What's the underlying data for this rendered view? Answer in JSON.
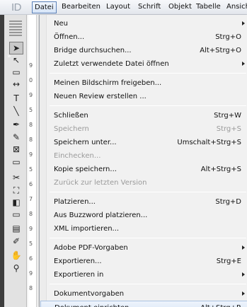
{
  "menubar": {
    "app_logo": "ID",
    "items": [
      "Datei",
      "Bearbeiten",
      "Layout",
      "Schrift",
      "Objekt",
      "Tabelle",
      "Ansicht"
    ],
    "active": "Datei"
  },
  "ruler_numbers": [
    "9",
    "0",
    "9",
    "5",
    "8",
    "8",
    "9",
    "5",
    "6",
    "7",
    "8",
    "9",
    "5",
    "6",
    "9",
    "8"
  ],
  "tools": [
    {
      "name": "selection-tool-icon",
      "glyph": "➤"
    },
    {
      "name": "direct-selection-tool-icon",
      "glyph": "↖"
    },
    {
      "name": "page-tool-icon",
      "glyph": "▭"
    },
    {
      "name": "gap-tool-icon",
      "glyph": "↔"
    },
    {
      "name": "type-tool-icon",
      "glyph": "T"
    },
    {
      "name": "line-tool-icon",
      "glyph": "╲"
    },
    {
      "name": "pen-tool-icon",
      "glyph": "✒"
    },
    {
      "name": "pencil-tool-icon",
      "glyph": "✎"
    },
    {
      "name": "rectangle-frame-tool-icon",
      "glyph": "⊠"
    },
    {
      "name": "rectangle-tool-icon",
      "glyph": "▭"
    },
    {
      "name": "scissors-tool-icon",
      "glyph": "✂"
    },
    {
      "name": "free-transform-tool-icon",
      "glyph": "⛶"
    },
    {
      "name": "gradient-swatch-tool-icon",
      "glyph": "◧"
    },
    {
      "name": "gradient-feather-tool-icon",
      "glyph": "▭"
    },
    {
      "name": "note-tool-icon",
      "glyph": "▤"
    },
    {
      "name": "eyedropper-tool-icon",
      "glyph": "✐"
    },
    {
      "name": "hand-tool-icon",
      "glyph": "✋"
    },
    {
      "name": "zoom-tool-icon",
      "glyph": "⚲"
    }
  ],
  "file_menu": [
    {
      "label": "Neu",
      "shortcut": "",
      "submenu": true,
      "disabled": false
    },
    {
      "label": "Öffnen...",
      "shortcut": "Strg+O",
      "submenu": false,
      "disabled": false
    },
    {
      "label": "Bridge durchsuchen...",
      "shortcut": "Alt+Strg+O",
      "submenu": false,
      "disabled": false
    },
    {
      "label": "Zuletzt verwendete Datei öffnen",
      "shortcut": "",
      "submenu": true,
      "disabled": false
    },
    {
      "label": "Meinen Bildschirm freigeben...",
      "shortcut": "",
      "submenu": false,
      "disabled": false
    },
    {
      "label": "Neuen Review erstellen ...",
      "shortcut": "",
      "submenu": false,
      "disabled": false
    },
    {
      "label": "Schließen",
      "shortcut": "Strg+W",
      "submenu": false,
      "disabled": false
    },
    {
      "label": "Speichern",
      "shortcut": "Strg+S",
      "submenu": false,
      "disabled": true
    },
    {
      "label": "Speichern unter...",
      "shortcut": "Umschalt+Strg+S",
      "submenu": false,
      "disabled": false
    },
    {
      "label": "Einchecken...",
      "shortcut": "",
      "submenu": false,
      "disabled": true
    },
    {
      "label": "Kopie speichern...",
      "shortcut": "Alt+Strg+S",
      "submenu": false,
      "disabled": false
    },
    {
      "label": "Zurück zur letzten Version",
      "shortcut": "",
      "submenu": false,
      "disabled": true
    },
    {
      "label": "Platzieren...",
      "shortcut": "Strg+D",
      "submenu": false,
      "disabled": false
    },
    {
      "label": "Aus Buzzword platzieren...",
      "shortcut": "",
      "submenu": false,
      "disabled": false
    },
    {
      "label": "XML importieren...",
      "shortcut": "",
      "submenu": false,
      "disabled": false
    },
    {
      "label": "Adobe PDF-Vorgaben",
      "shortcut": "",
      "submenu": true,
      "disabled": false
    },
    {
      "label": "Exportieren...",
      "shortcut": "Strg+E",
      "submenu": false,
      "disabled": false
    },
    {
      "label": "Exportieren in",
      "shortcut": "",
      "submenu": true,
      "disabled": false
    },
    {
      "label": "Dokumentvorgaben",
      "shortcut": "",
      "submenu": true,
      "disabled": false
    },
    {
      "label": "Dokument einrichten...",
      "shortcut": "Alt+Strg+P",
      "submenu": false,
      "disabled": false
    }
  ],
  "highlighted_item": "Dokument einrichten..."
}
